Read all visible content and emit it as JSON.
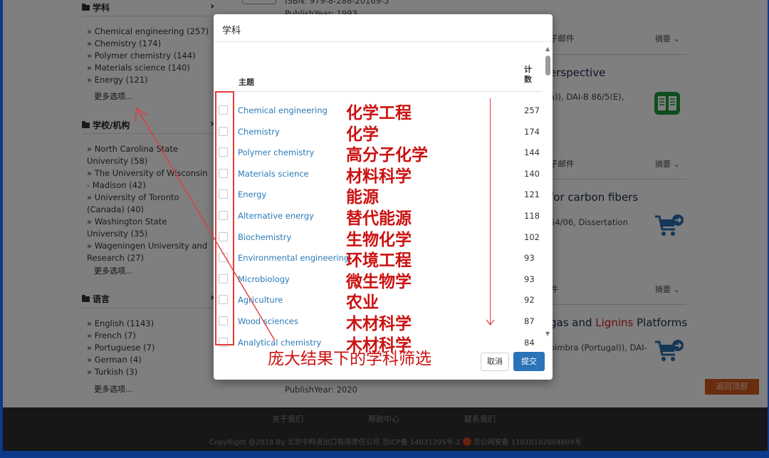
{
  "sidebar": {
    "subject": {
      "title": "学科",
      "items": [
        "» Chemical engineering  (257)",
        "» Chemistry  (174)",
        "» Polymer chemistry  (144)",
        "» Materials science  (140)",
        "» Energy  (121)"
      ],
      "more": "更多选项..."
    },
    "school": {
      "title": "学校/机构",
      "items": [
        "» North Carolina State University  (58)",
        "» The University of Wisconsin - Madison  (42)",
        "» University of Toronto (Canada)  (40)",
        "» Washington State University  (35)",
        "» Wageningen University and Research  (27)"
      ],
      "more": "更多选项..."
    },
    "language": {
      "title": "语言",
      "items": [
        "» English  (1143)",
        "» French  (7)",
        "» Portuguese  (7)",
        "» German  (4)",
        "» Turkish  (3)"
      ],
      "more": "更多选项..."
    }
  },
  "results": {
    "top_isbn": "ISBN: 979-8-288-20169-5",
    "top_publish": "PublishYear: 1993",
    "email_1": "子邮件",
    "abstract_1": "摘要 ⌄",
    "title_1": "erspective",
    "meta_1": "a)), DAI-B 86/5(E),",
    "email_2": "子邮件",
    "abstract_2": "摘要 ⌄",
    "title_2": "for carbon fibers",
    "meta_2": "54/06, Dissertation",
    "email_3": "件",
    "abstract_3": "摘要 ⌄",
    "title_3_pre": "gas and ",
    "title_3_hl": "Lignins",
    "title_3_post": " Platforms",
    "meta_3": "oimbra (Portugal)), DAI-",
    "publish_4": "PublishYear: 2020"
  },
  "back_to_top": "返回顶部",
  "footer": {
    "about": "关于我们",
    "help": "帮助中心",
    "contact": "联系我们",
    "copyright": "CopyRight @2018 By 北京中科进出口有限责任公司 京ICP备 14031295号-2",
    "police": "京公网安备 11010102004604号"
  },
  "modal": {
    "title": "学科",
    "header_subject": "主题",
    "header_count": "计数",
    "rows": [
      {
        "subject": "Chemical engineering",
        "count": "257",
        "zh": "化学工程"
      },
      {
        "subject": "Chemistry",
        "count": "174",
        "zh": "化学"
      },
      {
        "subject": "Polymer chemistry",
        "count": "144",
        "zh": "高分子化学"
      },
      {
        "subject": "Materials science",
        "count": "140",
        "zh": "材料科学"
      },
      {
        "subject": "Energy",
        "count": "121",
        "zh": "能源"
      },
      {
        "subject": "Alternative energy",
        "count": "118",
        "zh": "替代能源"
      },
      {
        "subject": "Biochemistry",
        "count": "102",
        "zh": "生物化学"
      },
      {
        "subject": "Environmental engineering",
        "count": "93",
        "zh": "环境工程"
      },
      {
        "subject": "Microbiology",
        "count": "93",
        "zh": "微生物学"
      },
      {
        "subject": "Agriculture",
        "count": "92",
        "zh": "农业"
      },
      {
        "subject": "Wood sciences",
        "count": "87",
        "zh": "木材科学"
      },
      {
        "subject": "Analytical chemistry",
        "count": "84",
        "zh": "木材科学"
      }
    ],
    "caption": "庞大结果下的学科筛选",
    "cancel": "取消",
    "submit": "提交"
  },
  "colors": {
    "annotation_red": "#cc1111",
    "link_blue": "#2a7ab8",
    "submit_blue": "#2a73b8",
    "frame_blue": "#0d3a8a"
  }
}
